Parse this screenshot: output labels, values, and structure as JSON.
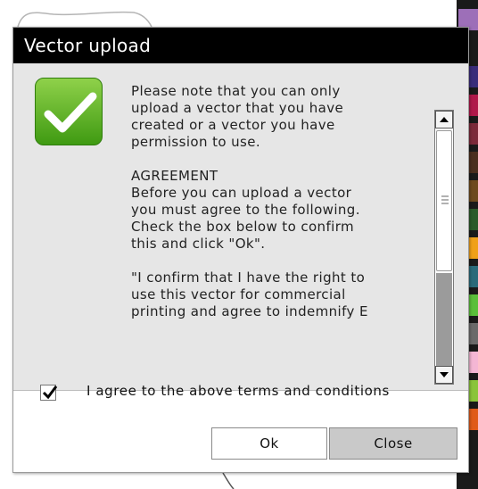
{
  "dialog": {
    "title": "Vector upload",
    "icon": "checkmark-badge-icon",
    "message_paragraphs": [
      "Please note that you can only\nupload a vector that you have\ncreated or a vector you have\npermission to use.",
      "AGREEMENT\nBefore you can upload a vector\nyou must agree to the following.\nCheck the box below to confirm\nthis and click \"Ok\".",
      "\"I confirm that I have the right to\nuse this vector for commercial\nprinting and agree to indemnify E"
    ],
    "agree_checked": true,
    "agree_label": "I agree to the above terms and conditions",
    "buttons": {
      "ok": "Ok",
      "close": "Close"
    }
  },
  "palette_colors": [
    "#9d6fb8",
    "#1a1a1a",
    "#3a2c7a",
    "#b0184a",
    "#7c2a3a",
    "#4a2e1e",
    "#6e4a1e",
    "#2c5a2a",
    "#f0a01a",
    "#2a6a7a",
    "#5abf3a",
    "#6a6a6a",
    "#f4b6d4",
    "#8ac43a",
    "#e05a1a"
  ]
}
